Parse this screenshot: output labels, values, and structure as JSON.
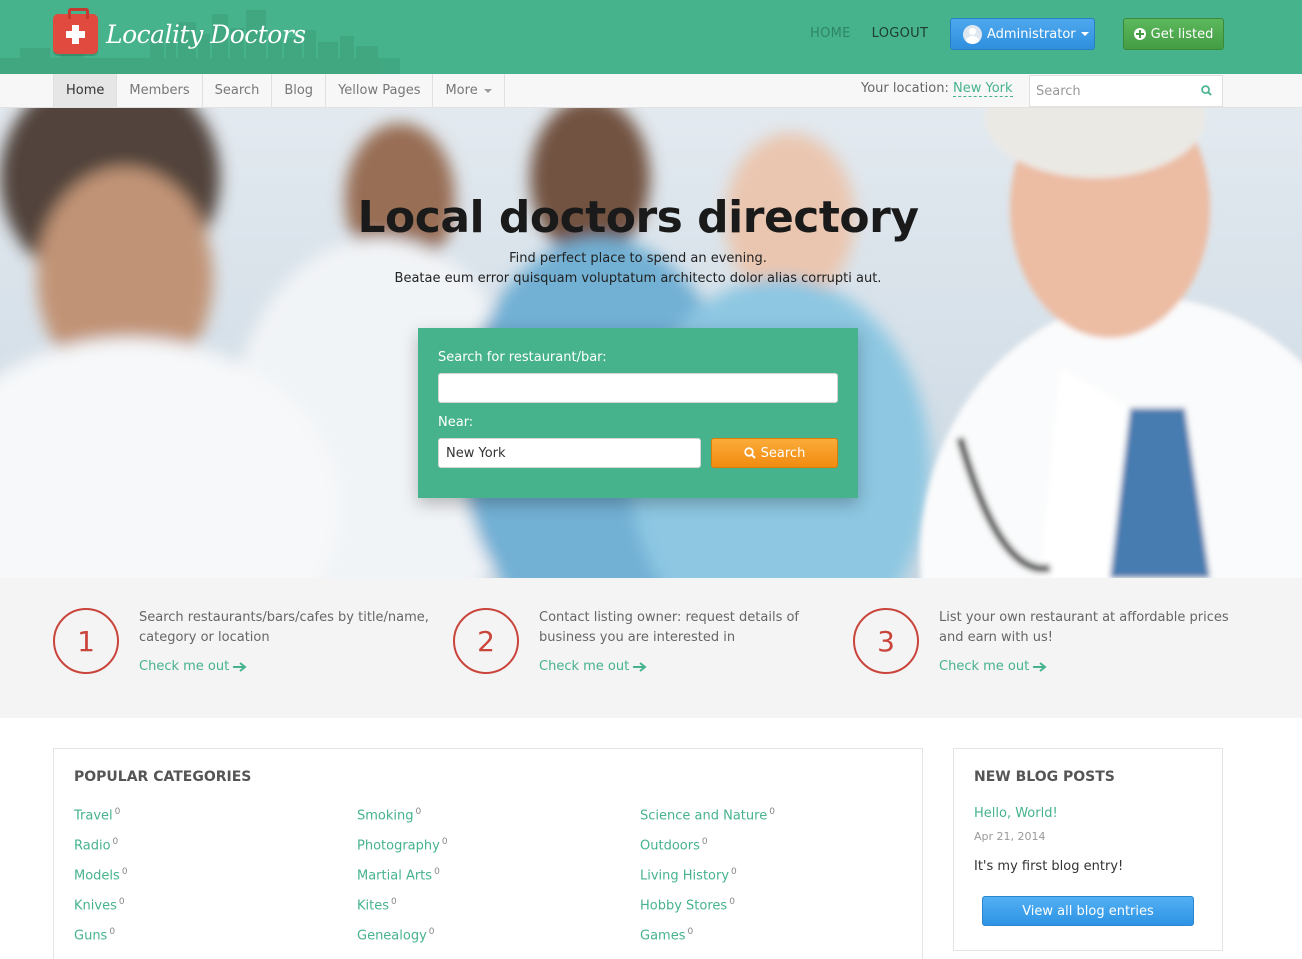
{
  "header": {
    "logo_text": "Locality Doctors",
    "links": {
      "home": "HOME",
      "logout": "LOGOUT"
    },
    "admin_button": "Administrator",
    "get_listed_button": "Get listed"
  },
  "nav": {
    "items": [
      "Home",
      "Members",
      "Search",
      "Blog",
      "Yellow Pages",
      "More"
    ],
    "location_label": "Your location:",
    "location_value": "New York",
    "search_placeholder": "Search"
  },
  "hero": {
    "title": "Local doctors directory",
    "subtitle_1": "Find perfect place to spend an evening.",
    "subtitle_2": "Beatae eum error quisquam voluptatum architecto dolor alias corrupti aut.",
    "search_label": "Search for restaurant/bar:",
    "search_value": "",
    "near_label": "Near:",
    "near_value": "New York",
    "search_button": "Search"
  },
  "steps": [
    {
      "number": "1",
      "text": "Search restaurants/bars/cafes by title/name, category or location",
      "link": "Check me out"
    },
    {
      "number": "2",
      "text": "Contact listing owner: request details of business you are interested in",
      "link": "Check me out"
    },
    {
      "number": "3",
      "text": "List your own restaurant at affordable prices and earn with us!",
      "link": "Check me out"
    }
  ],
  "categories": {
    "title": "POPULAR CATEGORIES",
    "columns": [
      [
        {
          "name": "Travel",
          "count": "0"
        },
        {
          "name": "Radio",
          "count": "0"
        },
        {
          "name": "Models",
          "count": "0"
        },
        {
          "name": "Knives",
          "count": "0"
        },
        {
          "name": "Guns",
          "count": "0"
        }
      ],
      [
        {
          "name": "Smoking",
          "count": "0"
        },
        {
          "name": "Photography",
          "count": "0"
        },
        {
          "name": "Martial Arts",
          "count": "0"
        },
        {
          "name": "Kites",
          "count": "0"
        },
        {
          "name": "Genealogy",
          "count": "0"
        }
      ],
      [
        {
          "name": "Science and Nature",
          "count": "0"
        },
        {
          "name": "Outdoors",
          "count": "0"
        },
        {
          "name": "Living History",
          "count": "0"
        },
        {
          "name": "Hobby Stores",
          "count": "0"
        },
        {
          "name": "Games",
          "count": "0"
        }
      ]
    ]
  },
  "blog": {
    "title": "NEW BLOG POSTS",
    "post_title": "Hello, World!",
    "post_date": "Apr 21, 2014",
    "post_text": "It's my first blog entry!",
    "button": "View all blog entries"
  },
  "colors": {
    "brand_green": "#46b38c",
    "accent_red": "#c9443b",
    "button_orange": "#f28b10",
    "button_blue": "#2e93e4",
    "button_green": "#449d44"
  },
  "icons": [
    "first-aid-kit-icon",
    "user-avatar-icon",
    "plus-circle-icon",
    "search-icon",
    "arrow-right-icon"
  ]
}
